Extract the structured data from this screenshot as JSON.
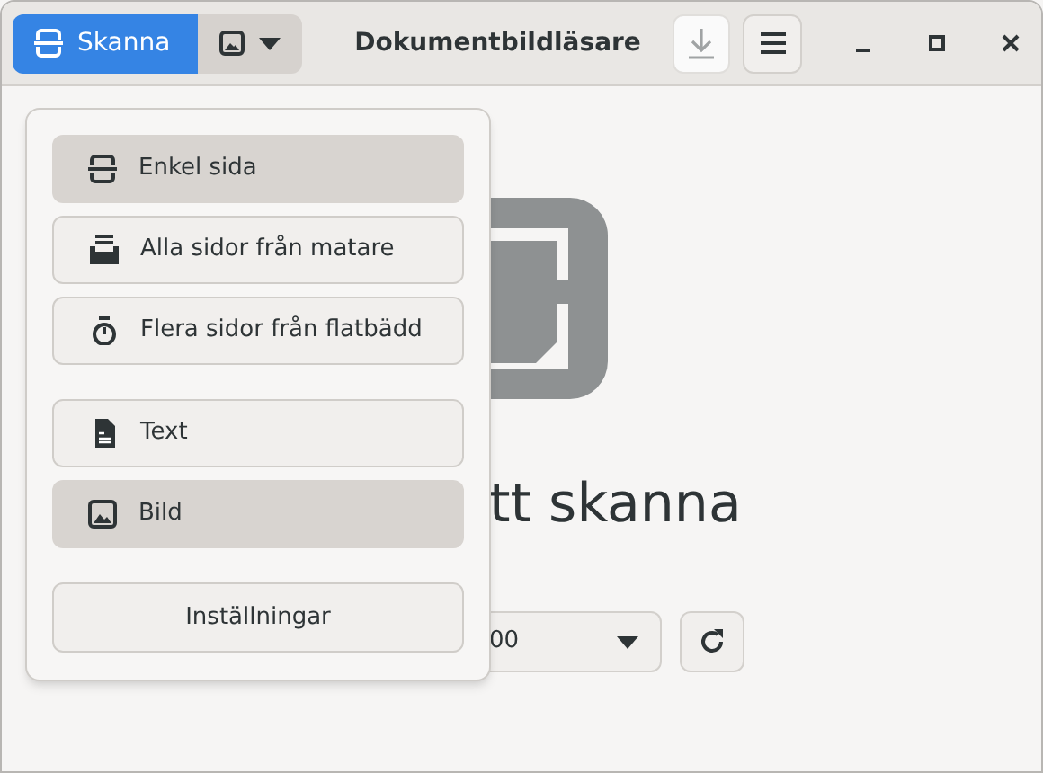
{
  "header": {
    "scan_button": {
      "label": "Skanna"
    },
    "format_toggle": {
      "pressed": true
    },
    "title": "Dokumentbildläsare",
    "save_button": {
      "disabled": true
    }
  },
  "background": {
    "status_text": "tt skanna",
    "device_dropdown": {
      "value": "00"
    }
  },
  "menu": {
    "sections": [
      {
        "items": [
          {
            "label": "Enkel sida",
            "selected": true
          },
          {
            "label": "Alla sidor från matare",
            "selected": false
          },
          {
            "label": "Flera sidor från flatbädd",
            "selected": false
          }
        ]
      },
      {
        "items": [
          {
            "label": "Text",
            "selected": false
          },
          {
            "label": "Bild",
            "selected": true
          }
        ]
      }
    ],
    "settings_button": {
      "label": "Inställningar"
    }
  }
}
